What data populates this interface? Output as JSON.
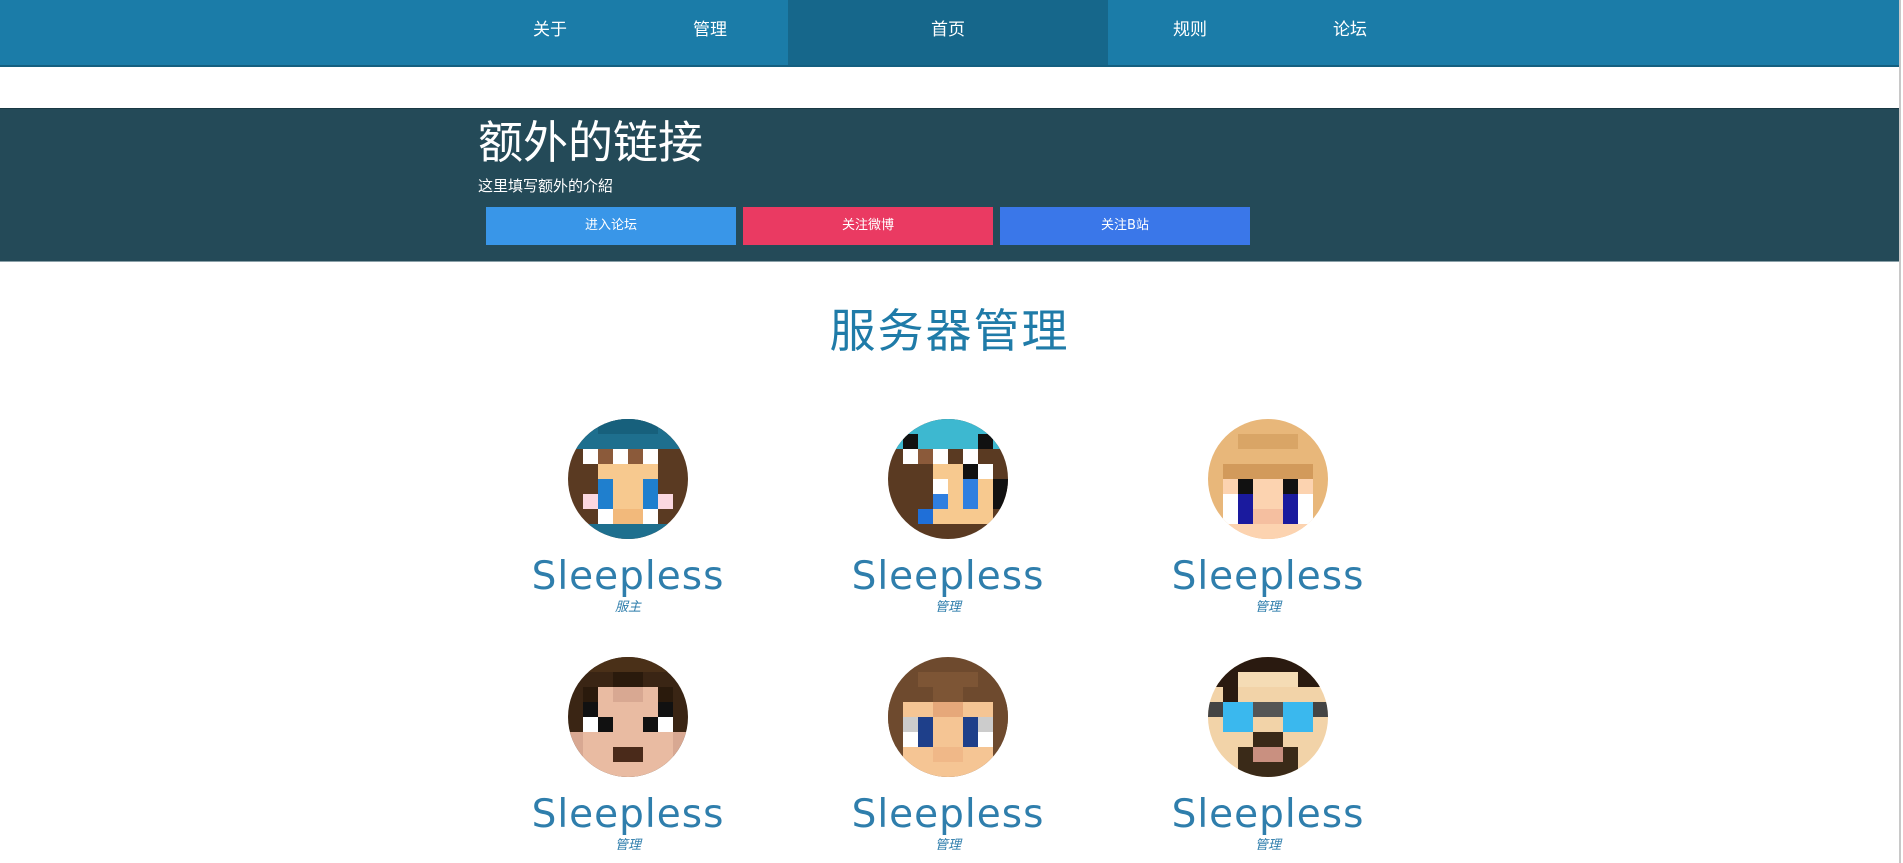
{
  "nav": {
    "items": [
      {
        "label": "关于"
      },
      {
        "label": "管理"
      },
      {
        "label": "首页"
      },
      {
        "label": "规则"
      },
      {
        "label": "论坛"
      }
    ]
  },
  "links": {
    "title": "额外的链接",
    "description": "这里填写额外的介紹",
    "buttons": [
      {
        "label": "进入论坛",
        "color": "#3996e8"
      },
      {
        "label": "关注微博",
        "color": "#ea3a62"
      },
      {
        "label": "关注B站",
        "color": "#3a77e9"
      }
    ]
  },
  "staff": {
    "title": "服务器管理",
    "members": [
      {
        "name": "Sleepless",
        "role": "服主",
        "avatar_icon": "pixel-avatar-teal-hat-icon"
      },
      {
        "name": "Sleepless",
        "role": "管理",
        "avatar_icon": "pixel-avatar-cyan-hat-icon"
      },
      {
        "name": "Sleepless",
        "role": "管理",
        "avatar_icon": "pixel-avatar-blonde-icon"
      },
      {
        "name": "Sleepless",
        "role": "管理",
        "avatar_icon": "pixel-avatar-dark-hair-icon"
      },
      {
        "name": "Sleepless",
        "role": "管理",
        "avatar_icon": "pixel-avatar-brown-hair-icon"
      },
      {
        "name": "Sleepless",
        "role": "管理",
        "avatar_icon": "pixel-avatar-goggles-icon"
      }
    ]
  },
  "colors": {
    "nav_bg": "#1b7ca8",
    "nav_active": "#16678b",
    "band_bg": "#244a58",
    "accent_text": "#1f7ba8"
  }
}
